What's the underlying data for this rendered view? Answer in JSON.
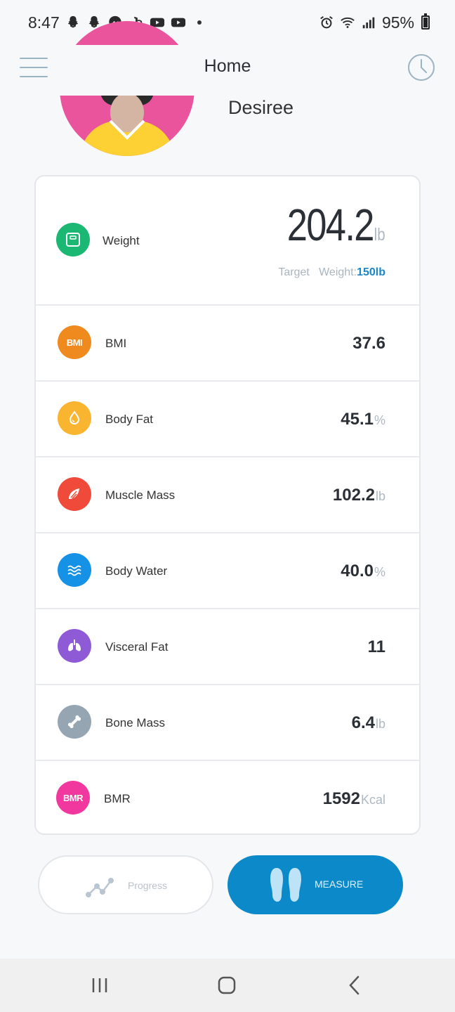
{
  "status_bar": {
    "time": "8:47",
    "battery": "95%",
    "icons": [
      "snapchat-icon",
      "snapchat-icon",
      "messenger-icon",
      "playstation-icon",
      "youtube-icon",
      "youtube-icon",
      "alarm-icon",
      "wifi-icon",
      "signal-icon",
      "battery-icon"
    ]
  },
  "header": {
    "title": "Home"
  },
  "profile": {
    "name": "Desiree"
  },
  "metrics": {
    "weight": {
      "label": "Weight",
      "value": "204.2",
      "unit": "lb",
      "target_label": "Target   Weight:",
      "target_value": "150lb",
      "color": "#1ab872"
    },
    "bmi": {
      "label": "BMI",
      "value": "37.6",
      "unit": "",
      "icon_text": "BMI",
      "color": "#ee8a1e"
    },
    "body_fat": {
      "label": "Body Fat",
      "value": "45.1",
      "unit": "%",
      "color": "#f9b430"
    },
    "muscle_mass": {
      "label": "Muscle Mass",
      "value": "102.2",
      "unit": "lb",
      "color": "#ef4a3a"
    },
    "body_water": {
      "label": "Body Water",
      "value": "40.0",
      "unit": "%",
      "color": "#1592e6"
    },
    "visceral_fat": {
      "label": "Visceral Fat",
      "value": "11",
      "unit": "",
      "color": "#8f5ad6"
    },
    "bone_mass": {
      "label": "Bone Mass",
      "value": "6.4",
      "unit": "lb",
      "color": "#95a6b2"
    },
    "bmr": {
      "label": "BMR",
      "value": "1592",
      "unit": "Kcal",
      "icon_text": "BMR",
      "color": "#f0389f"
    }
  },
  "actions": {
    "progress_label": "Progress",
    "measure_label": "MEASURE"
  }
}
